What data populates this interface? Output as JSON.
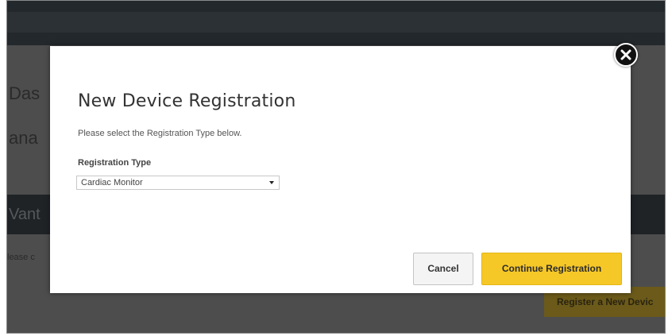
{
  "background": {
    "title_fragment_1": "Das",
    "title_fragment_2": "ana",
    "bar_fragment": "Vant",
    "text_fragment": "lease c",
    "register_button": "Register a New Devic"
  },
  "modal": {
    "title": "New Device Registration",
    "description": "Please select the Registration Type below.",
    "registration_type": {
      "label": "Registration Type",
      "selected_value": "Cardiac Monitor"
    },
    "cancel_label": "Cancel",
    "continue_label": "Continue Registration",
    "close_icon": "close-icon"
  },
  "colors": {
    "accent": "#f6c827",
    "overlay": "#4d4d4d",
    "topbar": "#23282c"
  }
}
